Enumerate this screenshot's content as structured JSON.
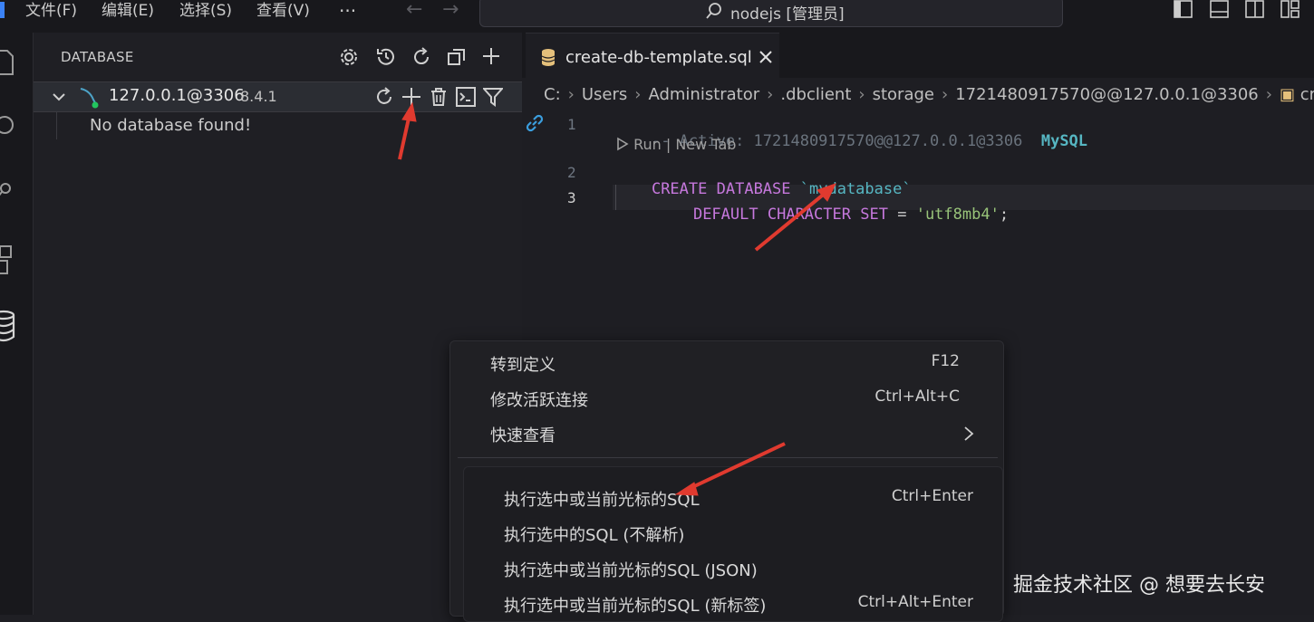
{
  "menubar": {
    "items": [
      "文件(F)",
      "编辑(E)",
      "选择(S)",
      "查看(V)"
    ],
    "more": "···",
    "command_center": "nodejs [管理员]"
  },
  "sidebar": {
    "title": "DATABASE",
    "connection": {
      "host": "127.0.0.1@3306",
      "version": "8.4.1"
    },
    "empty_message": "No database found!"
  },
  "editor": {
    "tab_label": "create-db-template.sql",
    "breadcrumb": [
      "C:",
      "Users",
      "Administrator",
      ".dbclient",
      "storage",
      "1721480917570@@127.0.0.1@3306",
      "creat"
    ],
    "codelens": "Run | New Tab",
    "lines": [
      {
        "num": "1",
        "comment": "-- Active: 1721480917570@@127.0.0.1@3306",
        "tag": "MySQL"
      },
      {
        "num": "2",
        "kw1": "CREATE",
        "kw2": "DATABASE",
        "ident": "`mydatabase`"
      },
      {
        "num": "3",
        "kw1": "DEFAULT",
        "kw2": "CHARACTER",
        "kw3": "SET",
        "op": "=",
        "str": "'utf8mb4'",
        "end": ";"
      }
    ]
  },
  "context_menu": {
    "group1": [
      {
        "label": "转到定义",
        "shortcut": "F12"
      },
      {
        "label": "修改活跃连接",
        "shortcut": "Ctrl+Alt+C"
      },
      {
        "label": "快速查看",
        "shortcut": ""
      }
    ],
    "group2": [
      {
        "label": "执行选中或当前光标的SQL",
        "shortcut": "Ctrl+Enter"
      },
      {
        "label": "执行选中的SQL (不解析)",
        "shortcut": ""
      },
      {
        "label": "执行选中或当前光标的SQL (JSON)",
        "shortcut": ""
      },
      {
        "label": "执行选中或当前光标的SQL (新标签)",
        "shortcut": "Ctrl+Alt+Enter"
      }
    ]
  },
  "watermark": "掘金技术社区 @ 想要去长安",
  "colors": {
    "accent_arrow": "#e03a2f",
    "keyword": "#c678dd",
    "identifier": "#56b6c2",
    "string": "#98c379",
    "online_dot": "#22c55e"
  }
}
